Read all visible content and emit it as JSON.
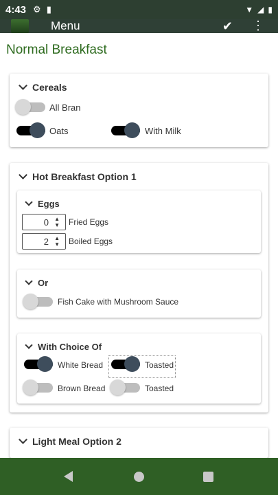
{
  "status": {
    "time": "4:43"
  },
  "appbar": {
    "title": "Menu"
  },
  "page": {
    "title": "Normal Breakfast"
  },
  "cereals": {
    "header": "Cereals",
    "all_bran": {
      "label": "All Bran",
      "on": false
    },
    "oats": {
      "label": "Oats",
      "on": true
    },
    "with_milk": {
      "label": "With Milk",
      "on": true
    }
  },
  "hot1": {
    "header": "Hot Breakfast Option 1",
    "eggs": {
      "header": "Eggs",
      "fried": {
        "value": "0",
        "label": "Fried Eggs"
      },
      "boiled": {
        "value": "2",
        "label": "Boiled Eggs"
      }
    },
    "or": {
      "header": "Or",
      "fish_cake": {
        "label": "Fish Cake with Mushroom Sauce",
        "on": false
      }
    },
    "choice": {
      "header": "With Choice Of",
      "white_bread": {
        "label": "White Bread",
        "on": true
      },
      "white_toasted": {
        "label": "Toasted",
        "on": true
      },
      "brown_bread": {
        "label": "Brown Bread",
        "on": false
      },
      "brown_toasted": {
        "label": "Toasted",
        "on": false
      }
    }
  },
  "light2": {
    "header": "Light Meal Option 2"
  },
  "colors": {
    "status_bar": "#2d3f31",
    "app_bar": "#2f4036",
    "accent_green": "#2e6b1f",
    "nav_bar": "#2f5f25",
    "knob_on": "#3e4d5c"
  }
}
